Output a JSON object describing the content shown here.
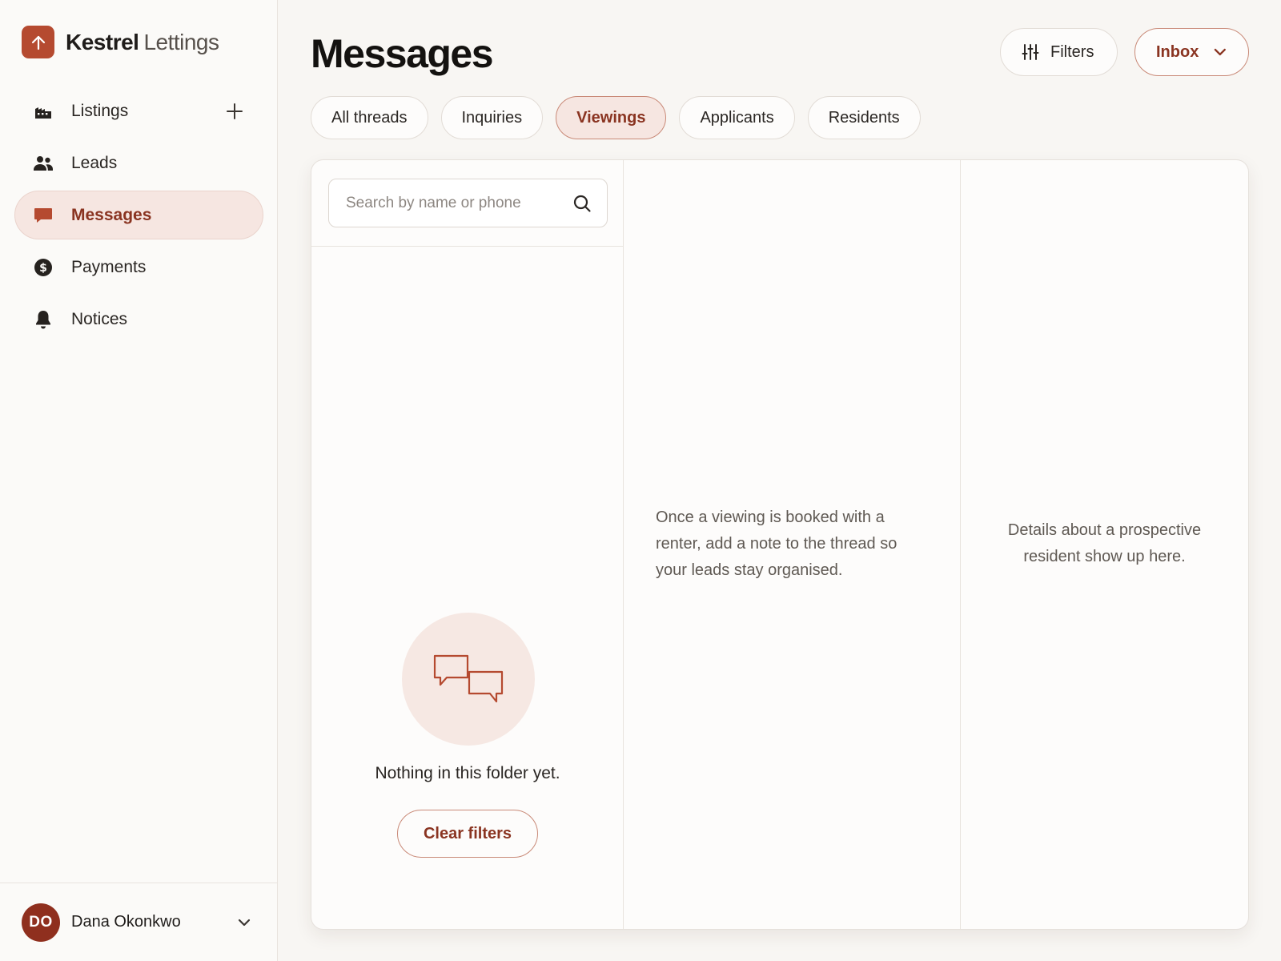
{
  "brand": {
    "name_bold": "Kestrel",
    "name_light": "Lettings",
    "logo_icon": "arrow-up-icon",
    "accent": "#b54a30"
  },
  "sidebar": {
    "items": [
      {
        "label": "Listings",
        "icon": "building-icon",
        "active": false,
        "has_add": true
      },
      {
        "label": "Leads",
        "icon": "people-icon",
        "active": false
      },
      {
        "label": "Messages",
        "icon": "chat-bubble-icon",
        "active": true
      },
      {
        "label": "Payments",
        "icon": "dollar-circle-icon",
        "active": false
      },
      {
        "label": "Notices",
        "icon": "bell-icon",
        "active": false
      }
    ]
  },
  "user": {
    "initials": "DO",
    "name": "Dana Okonkwo",
    "avatar_color": "#8f2f1e"
  },
  "header": {
    "title": "Messages",
    "filters_label": "Filters",
    "inbox_label": "Inbox"
  },
  "tabs": [
    {
      "label": "All threads",
      "active": false
    },
    {
      "label": "Inquiries",
      "active": false
    },
    {
      "label": "Viewings",
      "active": true
    },
    {
      "label": "Applicants",
      "active": false
    },
    {
      "label": "Residents",
      "active": false
    }
  ],
  "threads": {
    "search_placeholder": "Search by name or phone",
    "empty_text": "Nothing in this folder yet.",
    "clear_label": "Clear filters"
  },
  "conversation": {
    "hint": "Once a viewing is booked with a renter, add a note to the thread so your leads stay organised."
  },
  "details": {
    "hint": "Details about a prospective resident show up here."
  }
}
